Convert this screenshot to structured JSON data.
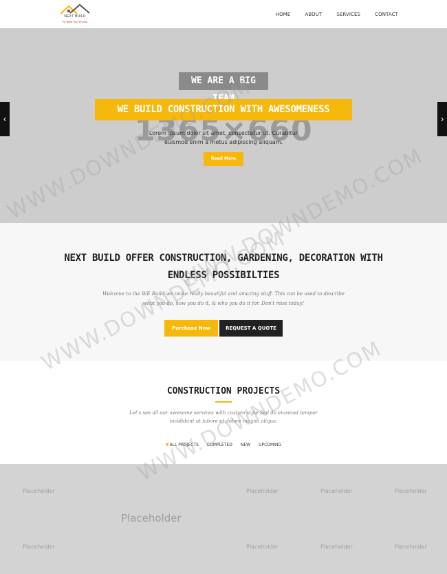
{
  "header": {
    "logo_name": "NEXT BUILD",
    "logo_tagline": "We Build Your Dreams",
    "nav": [
      "HOME",
      "ABOUT",
      "SERVICES",
      "CONTACT"
    ]
  },
  "hero": {
    "placeholder": "1365×660",
    "badge": "WE ARE A BIG TEAM",
    "title": "WE BUILD CONSTRUCTION WITH AWESOMENESS",
    "text": "Lorem ipsum dolor sit amet, consectetur ut. Curabitur euismod enim a metus adipiscing aliquam.",
    "button": "Read More",
    "prev_icon": "chevron-left-icon",
    "next_icon": "chevron-right-icon"
  },
  "offer": {
    "title": "NEXT BUILD OFFER CONSTRUCTION, GARDENING, DECORATION WITH ENDLESS POSSIBILTIES",
    "text": "Welcome to the WE Build we make really beautiful and amazing stuff. This can be used to describe what you do, how you do it, & who you do it for. Don't miss today!",
    "purchase_button": "Purchase Now",
    "quote_button": "REQUEST A QUOTE"
  },
  "projects": {
    "title": "CONSTRUCTION PROJECTS",
    "text": "Let's see all our awesome services with custom style Sed do eiusmod tempor incididunt ut labore et dolore magna aliqua.",
    "filters": [
      "ALL PROJECTS",
      "COMPLETED",
      "NEW",
      "UPCOMING"
    ]
  },
  "grid": {
    "placeholder": "Placeholder"
  },
  "watermark": "WWW.DOWNDEMO.COM",
  "colors": {
    "accent": "#f5b80b",
    "dark": "#222222",
    "hero_bg": "#cdcdcd",
    "badge_bg": "#8a8a8a"
  }
}
